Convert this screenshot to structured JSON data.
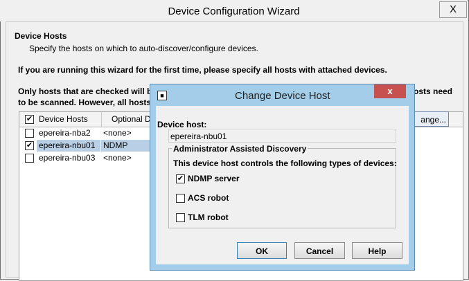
{
  "window": {
    "title": "Device Configuration Wizard",
    "close_glyph": "X"
  },
  "intro": {
    "heading": "Device Hosts",
    "subheading": "Specify the hosts on which to auto-discover/configure devices.",
    "line1": "If you are running this wizard for the first time, please specify all hosts with attached devices.",
    "line2_left": "Only hosts that are checked will b",
    "line2_right": "osts need",
    "line3": "to be scanned.  However, all hosts"
  },
  "table": {
    "headers": [
      "Device Hosts",
      "Optional D"
    ],
    "rows": [
      {
        "host": "epereira-nba2",
        "option": "<none>",
        "checked": false
      },
      {
        "host": "epereira-nbu01",
        "option": "NDMP",
        "checked": true
      },
      {
        "host": "epereira-nbu03",
        "option": "<none>",
        "checked": false
      }
    ]
  },
  "change_button": "ange...",
  "dialog": {
    "title": "Change Device Host",
    "close_glyph": "x",
    "device_host_label": "Device host:",
    "device_host_value": "epereira-nbu01",
    "group_label": "Administrator Assisted Discovery",
    "group_desc": "This device host controls the following types of devices:",
    "options": [
      {
        "label": "NDMP server",
        "checked": true
      },
      {
        "label": "ACS robot",
        "checked": false
      },
      {
        "label": "TLM robot",
        "checked": false
      }
    ],
    "buttons": {
      "ok": "OK",
      "cancel": "Cancel",
      "help": "Help"
    }
  }
}
